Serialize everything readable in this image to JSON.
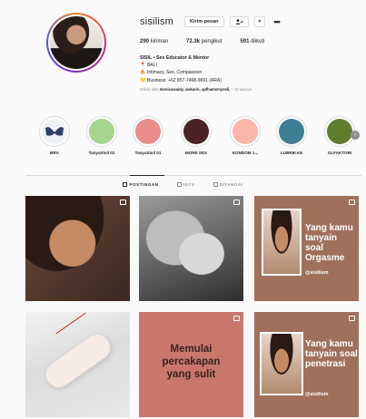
{
  "profile": {
    "username": "sisilism",
    "buttons": {
      "message": "Kirim pesan",
      "follow_icon": "person-check-icon",
      "dropdown": "▾",
      "more": "•••"
    },
    "stats": [
      {
        "value": "290",
        "label": "kiriman"
      },
      {
        "value": "72.3k",
        "label": "pengikut"
      },
      {
        "value": "591",
        "label": "diikuti"
      }
    ],
    "bio": {
      "name": "SISIL • Sex Educator & Mentor",
      "location": "BALI",
      "tagline": "Intimacy, Sex, Compassion",
      "business": "Business: +62 857-7468-9691 (ARA)",
      "followed_by_prefix": "Diikuti oleh",
      "followed_by_names": "monicawaidy, awkarin, apfhamsmyseli,",
      "followed_by_suffix": "+ 32 lainnya"
    }
  },
  "highlights": [
    {
      "label": "BRA",
      "color": "#e9eef5"
    },
    {
      "label": "TanyaSisil 02",
      "color": "#a8d58e"
    },
    {
      "label": "TanyaSisil 01",
      "color": "#e88c8c"
    },
    {
      "label": "MORE SEX",
      "color": "#4a2226"
    },
    {
      "label": "KONDOM 1...",
      "color": "#f8b7a8"
    },
    {
      "label": "LUBRIKAN",
      "color": "#3f7f96"
    },
    {
      "label": "OLFAKTORI",
      "color": "#5e7d2f"
    }
  ],
  "tabs": [
    {
      "label": "POSTINGAN",
      "active": true
    },
    {
      "label": "IGTV",
      "active": false
    },
    {
      "label": "DITANDAI",
      "active": false
    }
  ],
  "posts": {
    "p3": {
      "caption": "Yang kamu tanyain soal Orgasme",
      "handle": "@sisilism"
    },
    "p5": {
      "line1": "Memulai",
      "line2": "percakapan",
      "line3": "yang sulit"
    },
    "p6": {
      "caption": "Yang kamu tanyain soal penetrasi",
      "handle": "@sisilism"
    }
  }
}
